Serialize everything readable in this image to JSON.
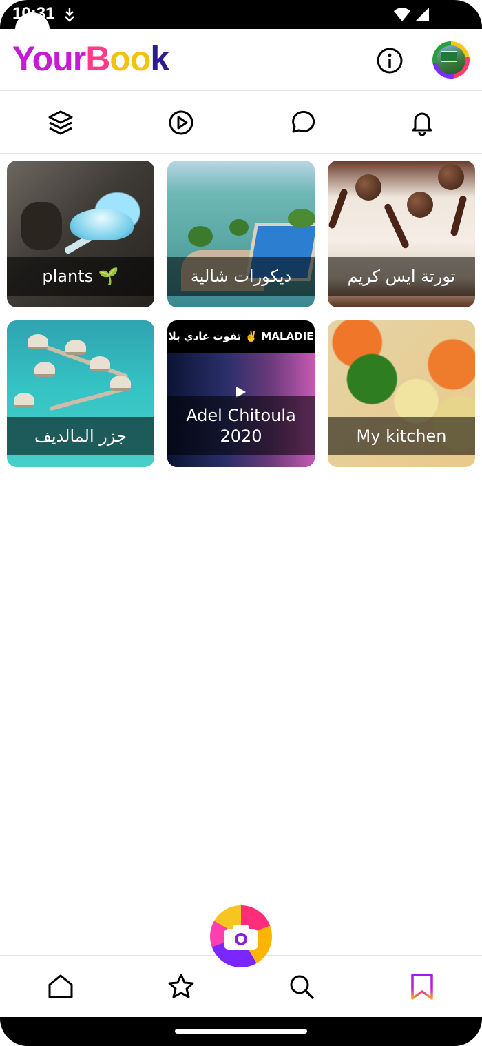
{
  "status_bar": {
    "time": "10:31"
  },
  "header": {
    "logo_part1": "Your",
    "logo_part2": "B",
    "logo_part3": "oo",
    "logo_part4": "k"
  },
  "tabs": [
    {
      "name": "layers-tab",
      "icon": "layers-icon"
    },
    {
      "name": "videos-tab",
      "icon": "play-circle-icon"
    },
    {
      "name": "messages-tab",
      "icon": "chat-bubble-icon"
    },
    {
      "name": "notifications-tab",
      "icon": "bell-icon"
    }
  ],
  "albums": [
    {
      "title": "plants 🌱"
    },
    {
      "title": "ديكورات شالية"
    },
    {
      "title": "تورتة ايس كريم"
    },
    {
      "title": "جزر المالديف"
    },
    {
      "title_line1": "Adel Chitoula",
      "title_line2": "2020",
      "caption": "تفوت عادي بلا ✌️ MALADIE"
    },
    {
      "title": "My kitchen"
    }
  ],
  "bottom_nav": {
    "items": [
      "home-icon",
      "star-icon",
      "search-icon",
      "bookmark-icon"
    ],
    "active": "bookmark-icon",
    "active_color": "#9b1fe8"
  }
}
